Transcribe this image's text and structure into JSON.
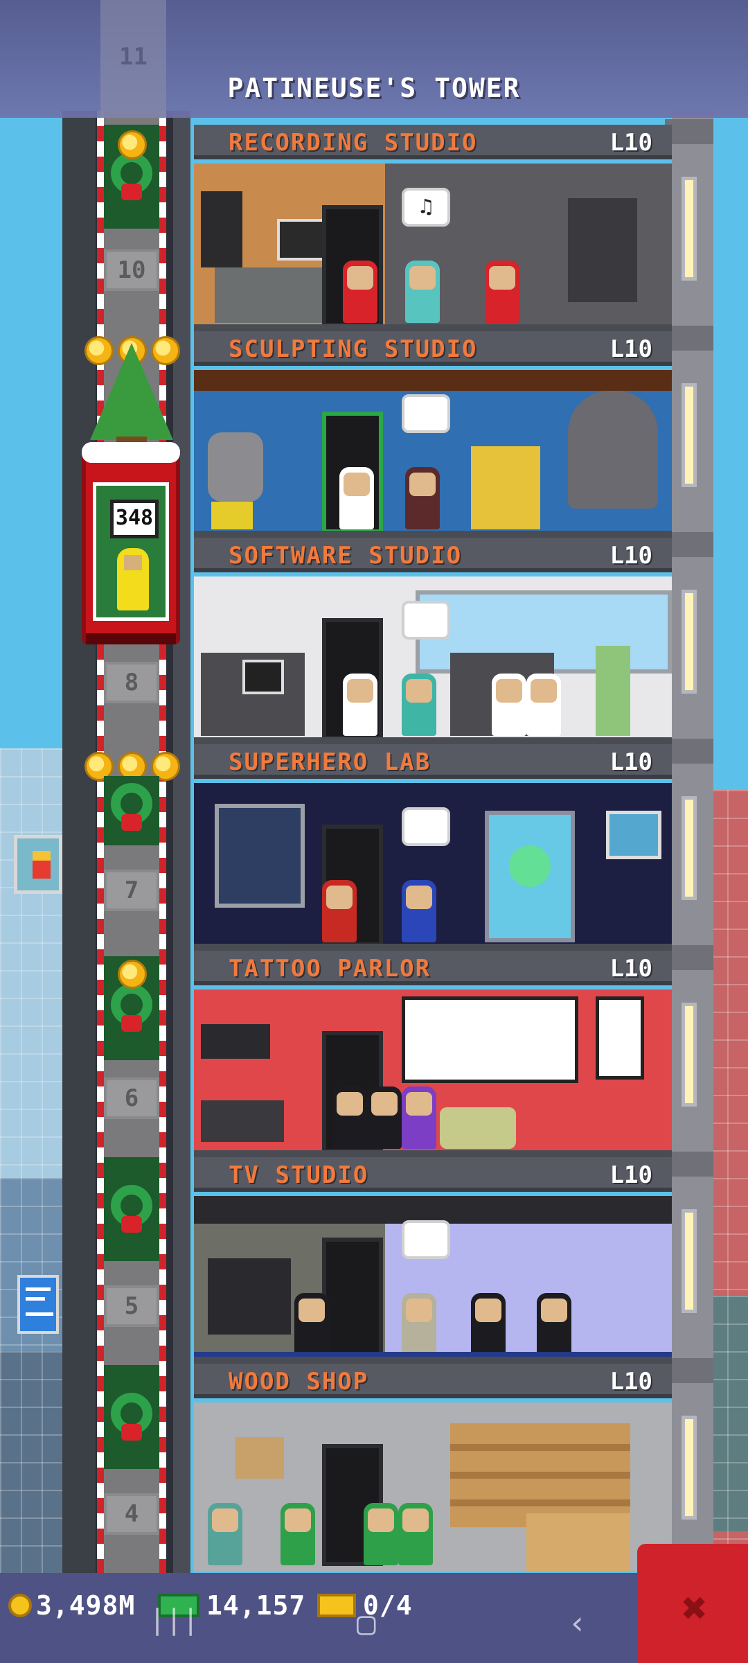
{
  "tower": {
    "title": "PATINEUSE'S TOWER",
    "ghost_floor_number": "11"
  },
  "elevator": {
    "display": "348",
    "floor_labels": [
      "10",
      "8",
      "7",
      "6",
      "5",
      "4"
    ]
  },
  "floors": [
    {
      "name": "RECORDING STUDIO",
      "level": "L10",
      "bubble": "♫"
    },
    {
      "name": "SCULPTING STUDIO",
      "level": "L10",
      "bubble": ""
    },
    {
      "name": "SOFTWARE STUDIO",
      "level": "L10",
      "bubble": ""
    },
    {
      "name": "SUPERHERO LAB",
      "level": "L10",
      "bubble": ""
    },
    {
      "name": "TATTOO PARLOR",
      "level": "L10",
      "bubble": ""
    },
    {
      "name": "TV STUDIO",
      "level": "L10",
      "bubble": ""
    },
    {
      "name": "WOOD SHOP",
      "level": "L10",
      "bubble": ""
    }
  ],
  "hud": {
    "coins": "3,498M",
    "bux": "14,157",
    "tickets": "0/4"
  },
  "colors": {
    "floor_name": "#f27a3c",
    "hud_bg": "#4f5285",
    "menu_button": "#d0222b",
    "elevator": "#c8141b"
  },
  "icons": {
    "coin": "coin-icon",
    "bux": "bux-icon",
    "ticket": "ticket-icon",
    "menu": "hammer-icon",
    "nav_recent": "recent-apps-icon",
    "nav_home": "home-icon",
    "nav_back": "back-icon"
  }
}
